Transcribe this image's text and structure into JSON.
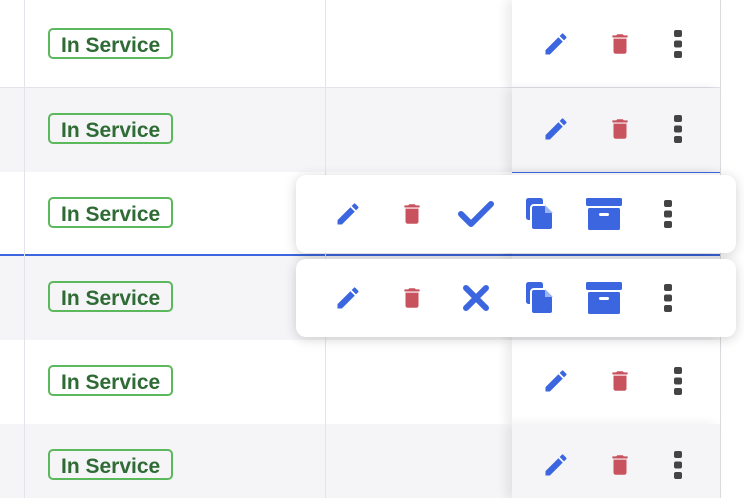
{
  "rows": [
    {
      "status": "In Service"
    },
    {
      "status": "In Service"
    },
    {
      "status": "In Service"
    },
    {
      "status": "In Service"
    },
    {
      "status": "In Service"
    },
    {
      "status": "In Service"
    }
  ],
  "colors": {
    "badge_border": "#5cb85c",
    "badge_text": "#2f6b35",
    "action_blue": "#3b66e0",
    "delete_red": "#c8525d",
    "more_gray": "#444444"
  },
  "row_actions": [
    "pencil-icon",
    "trash-icon",
    "more-vertical-icon"
  ],
  "popover_actions_approve": [
    "pencil-icon",
    "trash-icon",
    "check-icon",
    "copy-icon",
    "archive-icon",
    "more-vertical-icon"
  ],
  "popover_actions_reject": [
    "pencil-icon",
    "trash-icon",
    "close-icon",
    "copy-icon",
    "archive-icon",
    "more-vertical-icon"
  ]
}
